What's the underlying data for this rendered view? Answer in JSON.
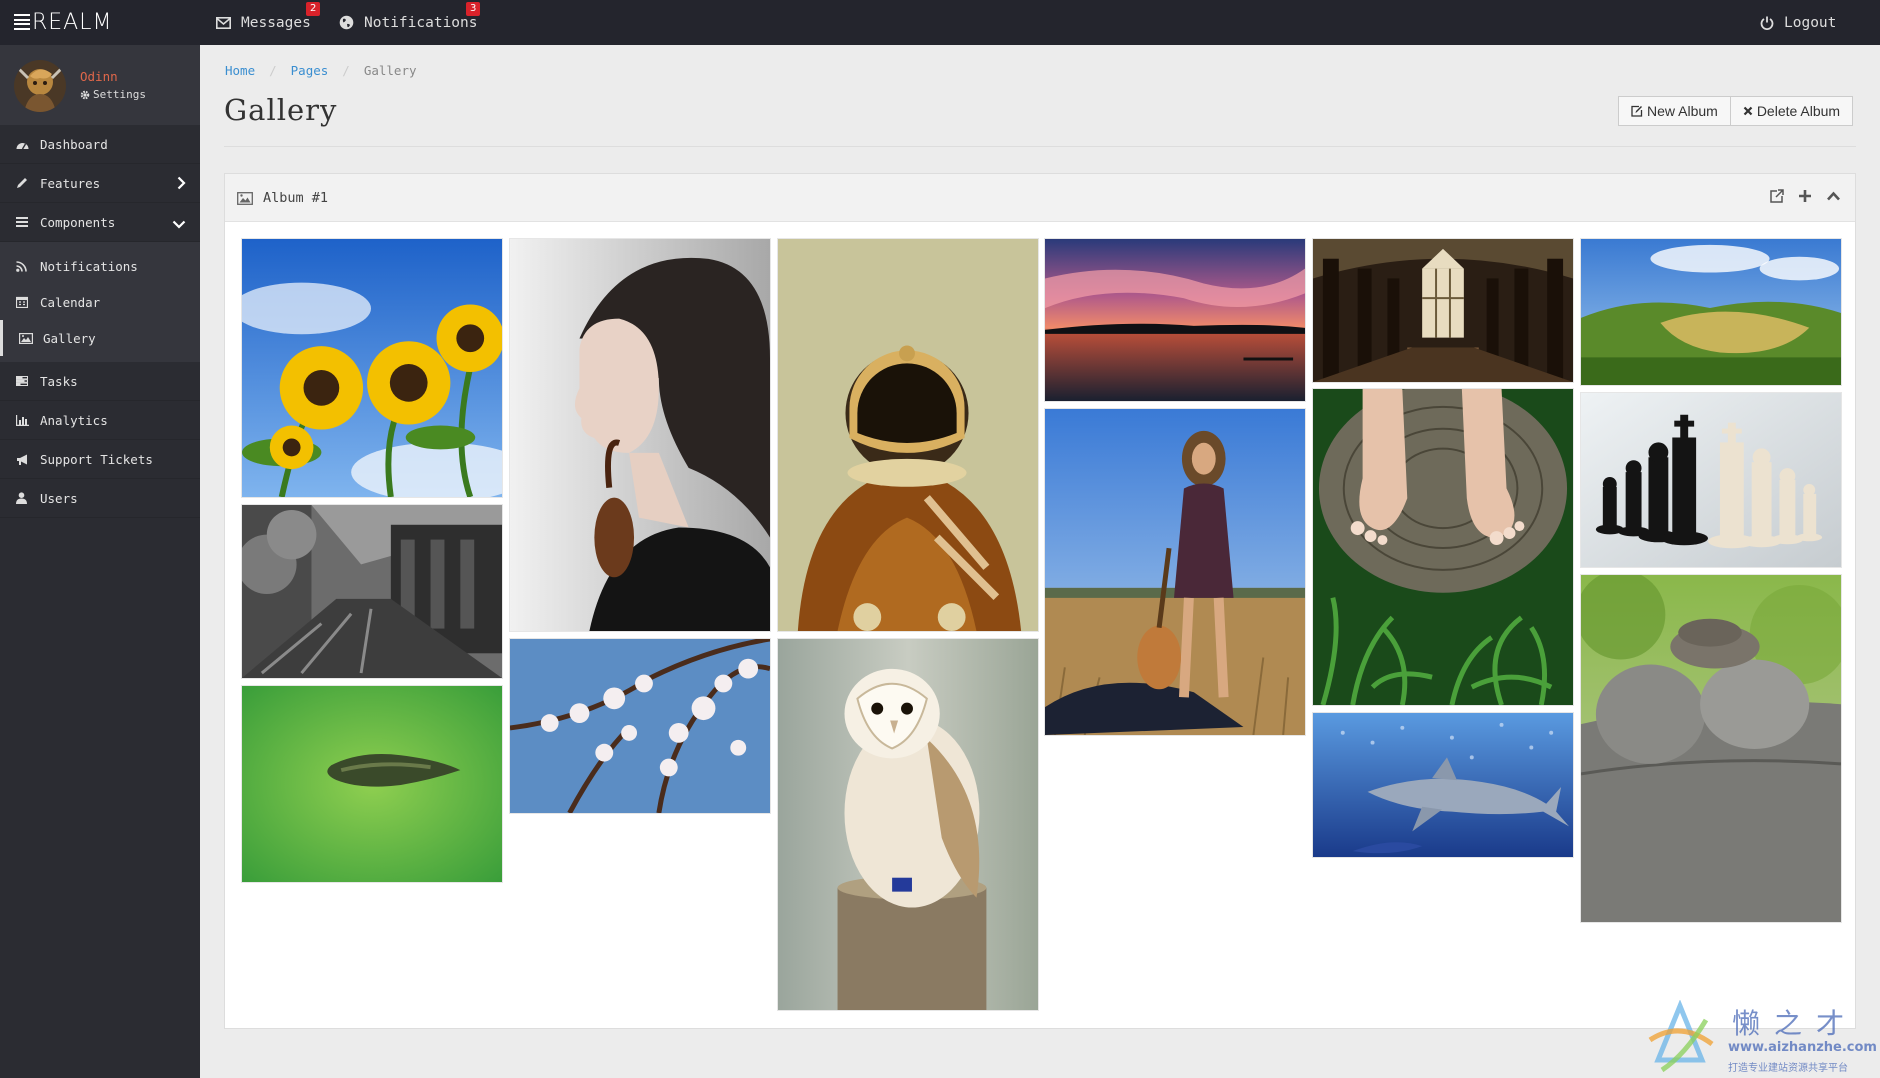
{
  "brand": {
    "name": "REALM"
  },
  "topbar": {
    "messages": {
      "label": "Messages",
      "count": "2"
    },
    "notifications": {
      "label": "Notifications",
      "count": "3"
    },
    "logout": {
      "label": "Logout"
    }
  },
  "user": {
    "name": "Odinn",
    "settings": "Settings"
  },
  "sidebar": {
    "items": [
      {
        "label": "Dashboard",
        "icon": "dashboard-icon"
      },
      {
        "label": "Features",
        "icon": "pencil-icon"
      },
      {
        "label": "Components",
        "icon": "bars-icon"
      },
      {
        "label": "Notifications",
        "icon": "rss-icon"
      },
      {
        "label": "Calendar",
        "icon": "calendar-icon"
      },
      {
        "label": "Gallery",
        "icon": "picture-icon"
      },
      {
        "label": "Tasks",
        "icon": "tasks-icon"
      },
      {
        "label": "Analytics",
        "icon": "bar-chart-icon"
      },
      {
        "label": "Support Tickets",
        "icon": "bullhorn-icon"
      },
      {
        "label": "Users",
        "icon": "user-icon"
      }
    ]
  },
  "breadcrumb": {
    "home": "Home",
    "pages": "Pages",
    "current": "Gallery"
  },
  "page": {
    "title": "Gallery",
    "new_album": "New Album",
    "delete_album": "Delete Album"
  },
  "album": {
    "title": "Album #1",
    "photos": [
      "sunflowers",
      "violinist",
      "astronaut",
      "sunset-lake",
      "cathedral",
      "green-hills",
      "ruined-corridor",
      "island",
      "cherry-blossom",
      "barn-owl",
      "guitar-girl",
      "bare-feet",
      "shark",
      "chess-pieces",
      "stacked-stones"
    ]
  },
  "watermark": {
    "name": "懒之才",
    "url": "www.aizhanzhe.com",
    "tagline": "打造专业建站资源共享平台"
  }
}
